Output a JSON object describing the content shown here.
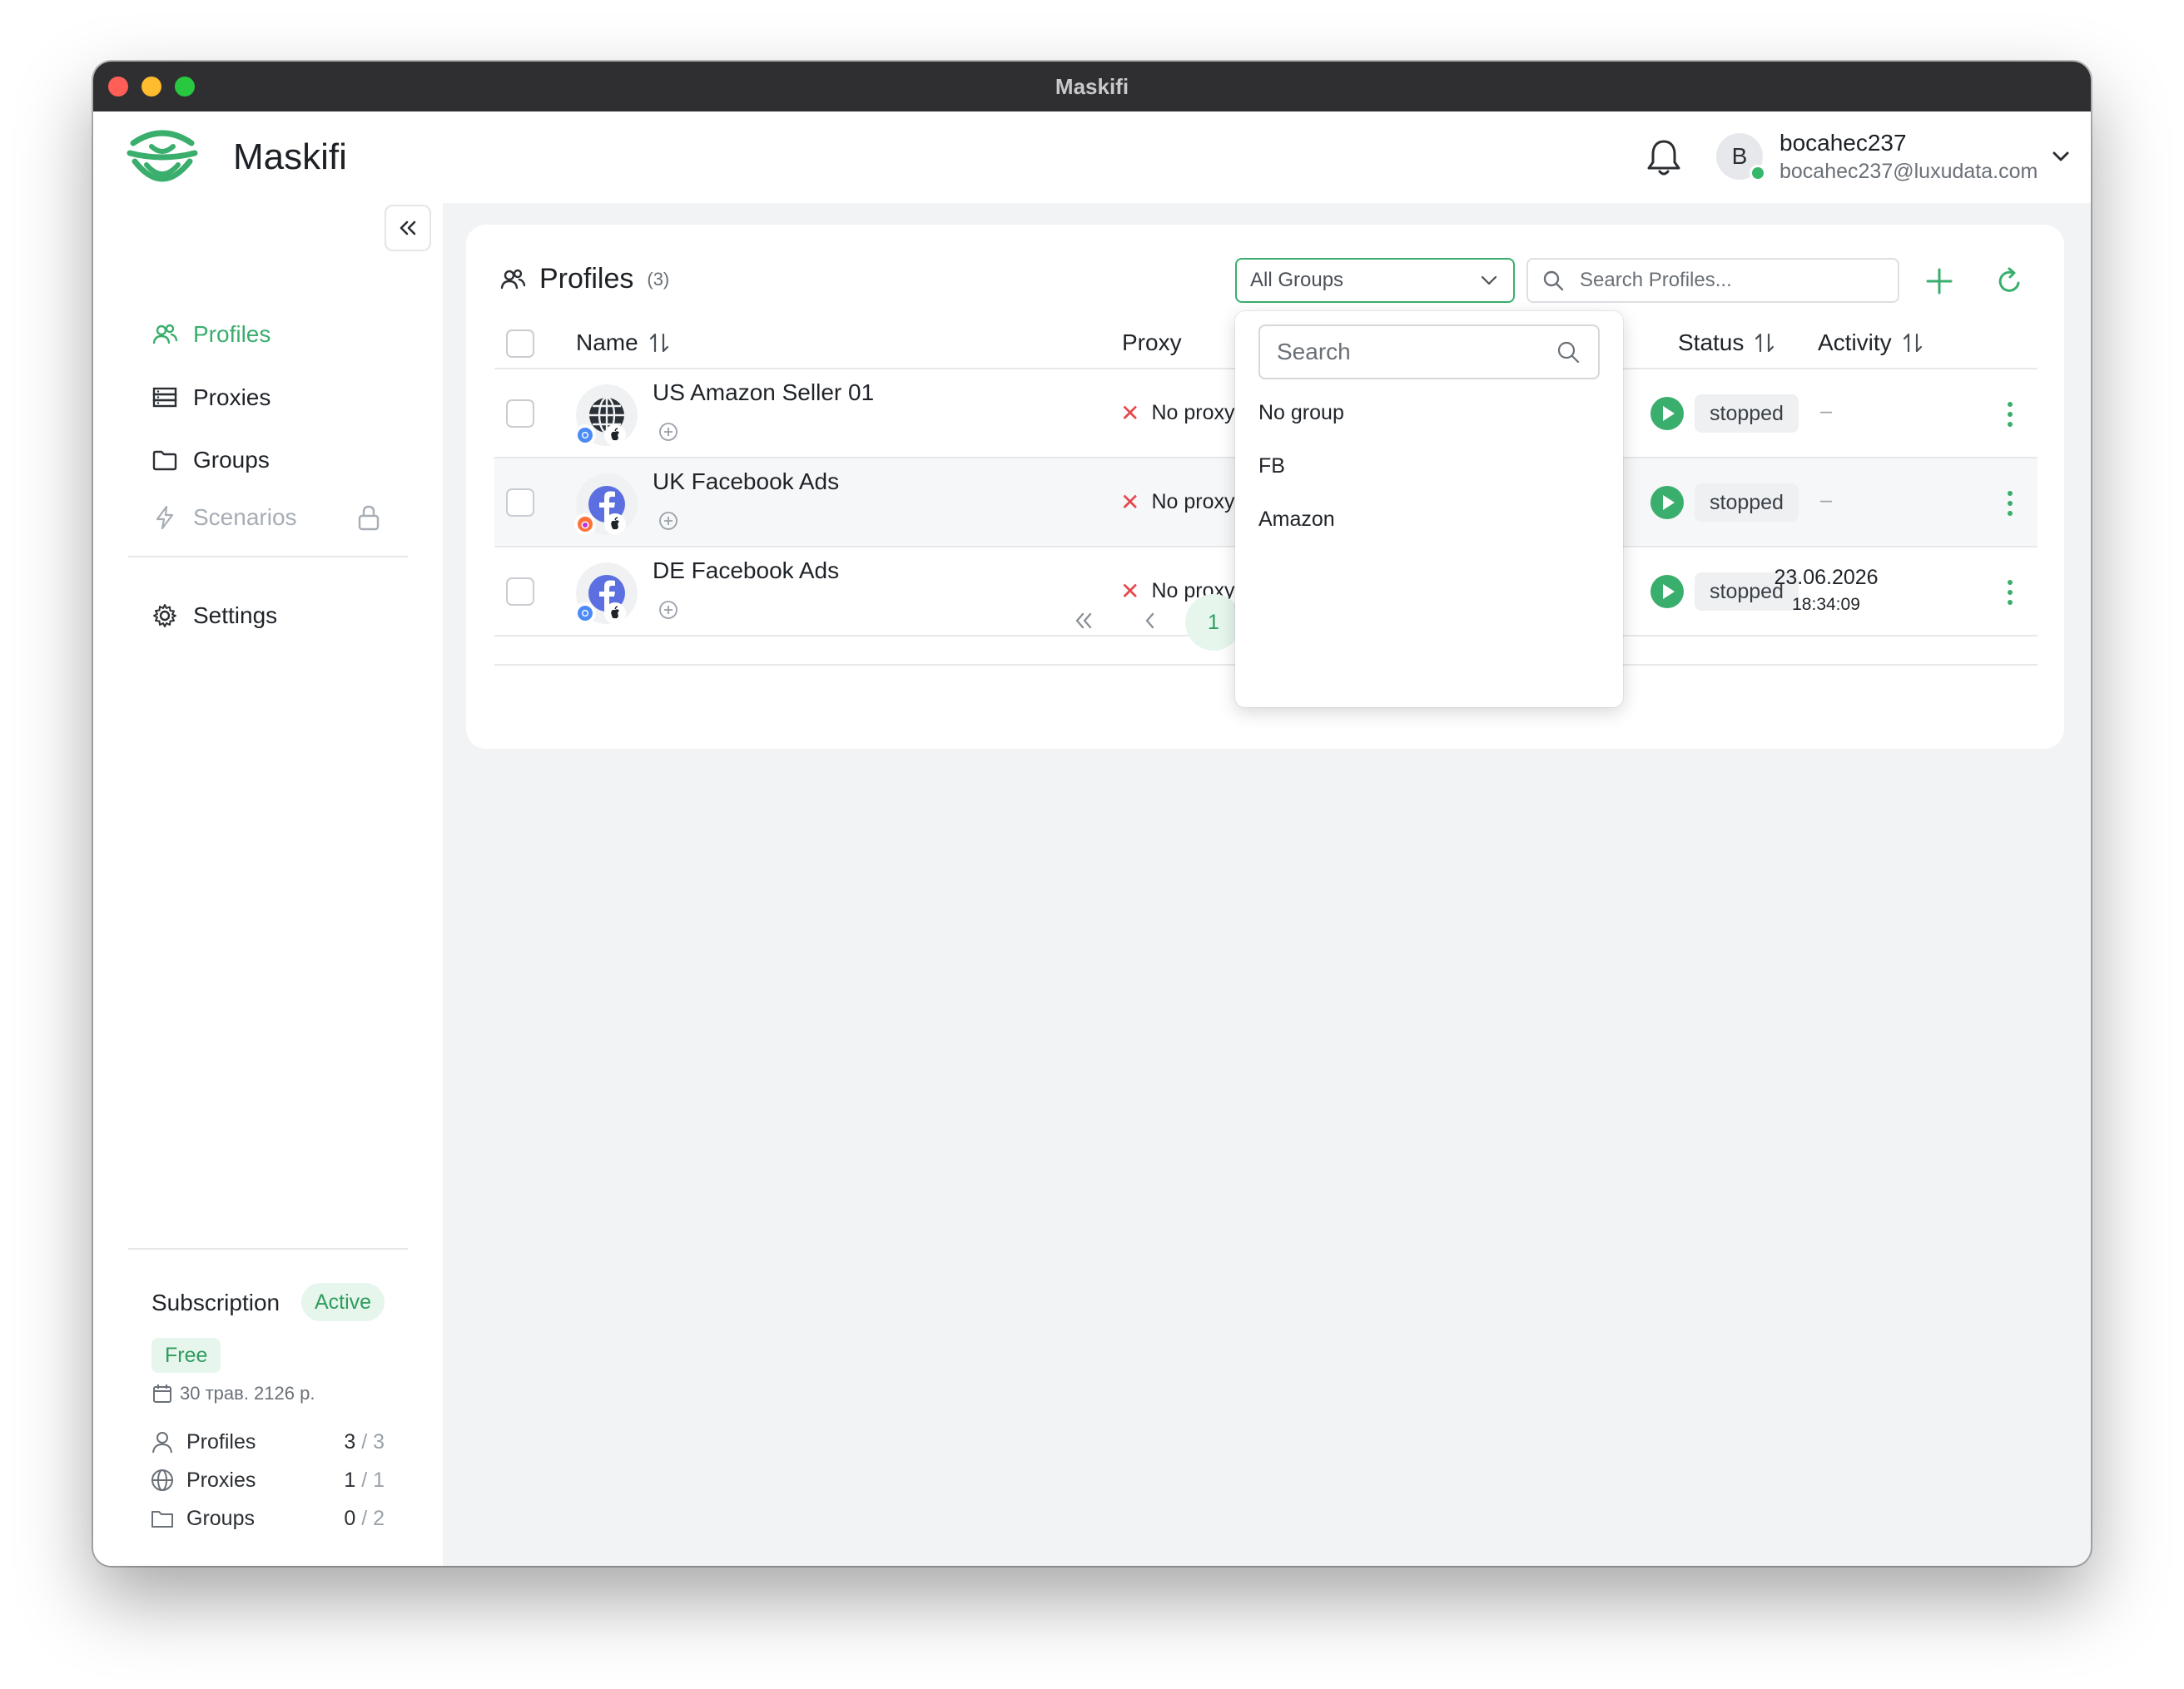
{
  "window": {
    "title": "Maskifi"
  },
  "header": {
    "app_name": "Maskifi",
    "user": {
      "initial": "B",
      "name": "bocahec237",
      "email": "bocahec237@luxudata.com"
    }
  },
  "sidebar": {
    "items": [
      {
        "label": "Profiles",
        "icon": "users-icon",
        "active": true
      },
      {
        "label": "Proxies",
        "icon": "server-icon"
      },
      {
        "label": "Groups",
        "icon": "folder-icon"
      },
      {
        "label": "Scenarios",
        "icon": "lightning-icon",
        "locked": true
      },
      {
        "label": "Settings",
        "icon": "gear-icon"
      }
    ],
    "subscription": {
      "title": "Subscription",
      "status": "Active",
      "plan": "Free",
      "date": "30 трав. 2126 р.",
      "limits": [
        {
          "label": "Profiles",
          "used": "3",
          "limit": "/ 3"
        },
        {
          "label": "Proxies",
          "used": "1",
          "limit": "/ 1"
        },
        {
          "label": "Groups",
          "used": "0",
          "limit": "/ 2"
        }
      ]
    }
  },
  "main": {
    "title": "Profiles",
    "count": "(3)",
    "group_filter": "All Groups",
    "search_placeholder": "Search Profiles...",
    "columns": {
      "name": "Name",
      "proxy": "Proxy",
      "status": "Status",
      "activity": "Activity"
    },
    "rows": [
      {
        "name": "US Amazon Seller 01",
        "icon": "globe-icon",
        "browser": "chrome-icon",
        "os": "apple-icon",
        "proxy": "No proxy",
        "status": "stopped",
        "activity": "–",
        "activity_time": ""
      },
      {
        "name": "UK Facebook Ads",
        "icon": "facebook-icon",
        "browser": "firefox-icon",
        "os": "apple-icon",
        "proxy": "No proxy",
        "status": "stopped",
        "activity": "–",
        "activity_time": ""
      },
      {
        "name": "DE Facebook Ads",
        "icon": "facebook-icon",
        "browser": "chrome-icon",
        "os": "apple-icon",
        "proxy": "No proxy",
        "status": "stopped",
        "activity": "23.06.2026",
        "activity_time": "18:34:09"
      }
    ],
    "pagination": {
      "current_page": "1"
    }
  },
  "group_dropdown": {
    "search_placeholder": "Search",
    "options": [
      "No group",
      "FB",
      "Amazon"
    ]
  },
  "colors": {
    "accent": "#3aae6c",
    "danger": "#e5484d",
    "titlebar": "#2f2f31"
  }
}
